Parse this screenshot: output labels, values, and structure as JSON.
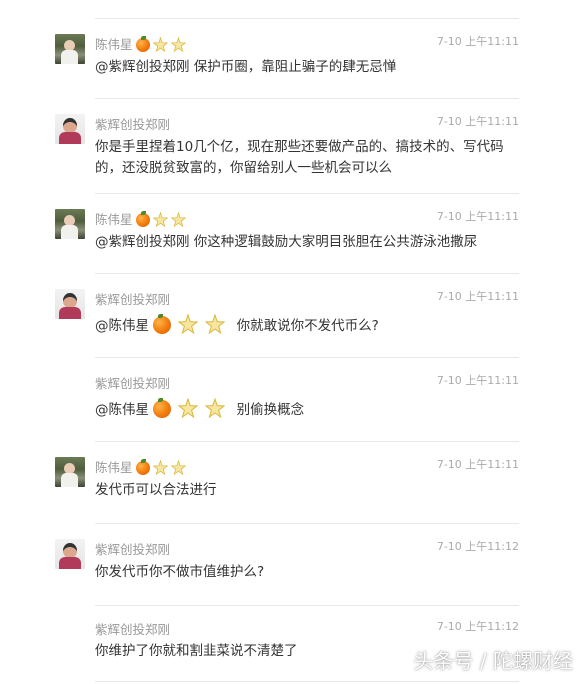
{
  "comments": [
    {
      "author": "陈伟星",
      "badges": [
        "orange-icon",
        "star-icon",
        "star-icon"
      ],
      "time": "7-10 上午11:11",
      "mention": "@紫辉创投郑刚",
      "text": " 保护币圈，靠阻止骗子的肆无忌惮"
    },
    {
      "author": "紫辉创投郑刚",
      "time": "7-10 上午11:11",
      "text": "你是手里捏着10几个亿，现在那些还要做产品的、搞技术的、写代码的，还没脱贫致富的，你留给别人一些机会可以么"
    },
    {
      "author": "陈伟星",
      "badges": [
        "orange-icon",
        "star-icon",
        "star-icon"
      ],
      "time": "7-10 上午11:11",
      "mention": "@紫辉创投郑刚",
      "text": " 你这种逻辑鼓励大家明目张胆在公共游泳池撒尿"
    },
    {
      "author": "紫辉创投郑刚",
      "time": "7-10 上午11:11",
      "mention": "@陈伟星",
      "text": "你就敢说你不发代币么?"
    },
    {
      "author": "紫辉创投郑刚",
      "time": "7-10 上午11:11",
      "mention": "@陈伟星",
      "text": "别偷换概念"
    },
    {
      "author": "陈伟星",
      "badges": [
        "orange-icon",
        "star-icon",
        "star-icon"
      ],
      "time": "7-10 上午11:11",
      "text": "发代币可以合法进行"
    },
    {
      "author": "紫辉创投郑刚",
      "time": "7-10 上午11:12",
      "text": "你发代币你不做市值维护么?"
    },
    {
      "author": "紫辉创投郑刚",
      "time": "7-10 上午11:12",
      "text": "你维护了你就和割韭菜说不清楚了"
    }
  ],
  "watermark": "头条号 / 陀螺财经"
}
